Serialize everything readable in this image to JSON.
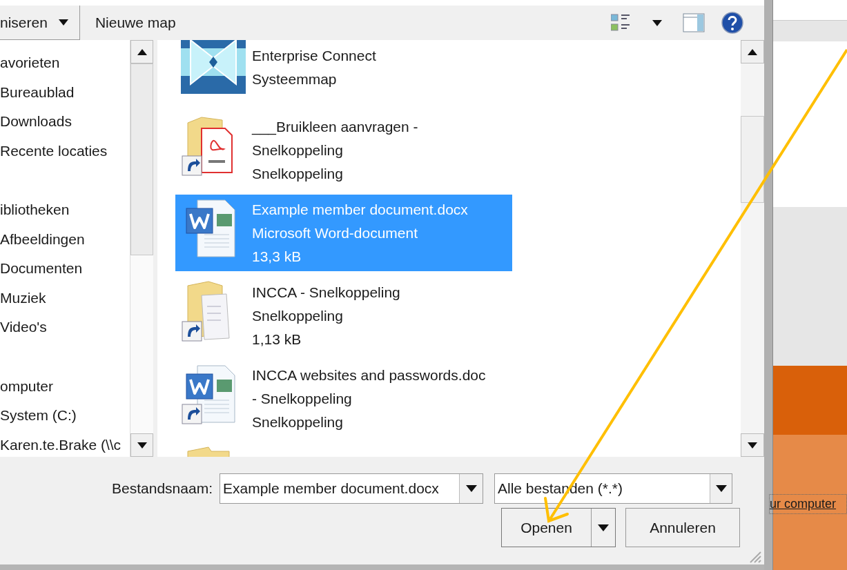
{
  "toolbar": {
    "organize_button": "niseren",
    "new_folder_button": "Nieuwe map"
  },
  "navigation": [
    {
      "label": "avorieten",
      "children": [
        {
          "label": "Bureaublad"
        },
        {
          "label": "Downloads"
        },
        {
          "label": "Recente locaties"
        }
      ]
    },
    {
      "label": "ibliotheken",
      "children": [
        {
          "label": "Afbeeldingen"
        },
        {
          "label": "Documenten"
        },
        {
          "label": "Muziek"
        },
        {
          "label": "Video's"
        }
      ]
    },
    {
      "label": "omputer",
      "children": [
        {
          "label": "System (C:)"
        },
        {
          "label": "Karen.te.Brake (\\\\c"
        }
      ]
    }
  ],
  "files": [
    {
      "kind": "system",
      "lines": [
        "Enterprise Connect",
        "Systeemmap"
      ],
      "selected": false
    },
    {
      "kind": "pdf-shortcut",
      "lines": [
        "___Bruikleen aanvragen -",
        "Snelkoppeling",
        "Snelkoppeling"
      ],
      "selected": false
    },
    {
      "kind": "word",
      "lines": [
        "Example member document.docx",
        "Microsoft Word-document",
        "13,3 kB"
      ],
      "selected": true
    },
    {
      "kind": "folder-shortcut",
      "lines": [
        "INCCA - Snelkoppeling",
        "Snelkoppeling",
        "1,13 kB"
      ],
      "selected": false
    },
    {
      "kind": "word-shortcut",
      "lines": [
        "INCCA websites and passwords.doc",
        "- Snelkoppeling",
        "Snelkoppeling"
      ],
      "selected": false
    },
    {
      "kind": "folder",
      "selected": false
    }
  ],
  "filename": {
    "label": "Bestandsnaam:",
    "value": "Example member document.docx"
  },
  "filetype": {
    "value": "Alle bestanden (*.*)"
  },
  "buttons": {
    "open": "Openen",
    "cancel": "Annuleren"
  },
  "background": {
    "link": "ur computer"
  }
}
